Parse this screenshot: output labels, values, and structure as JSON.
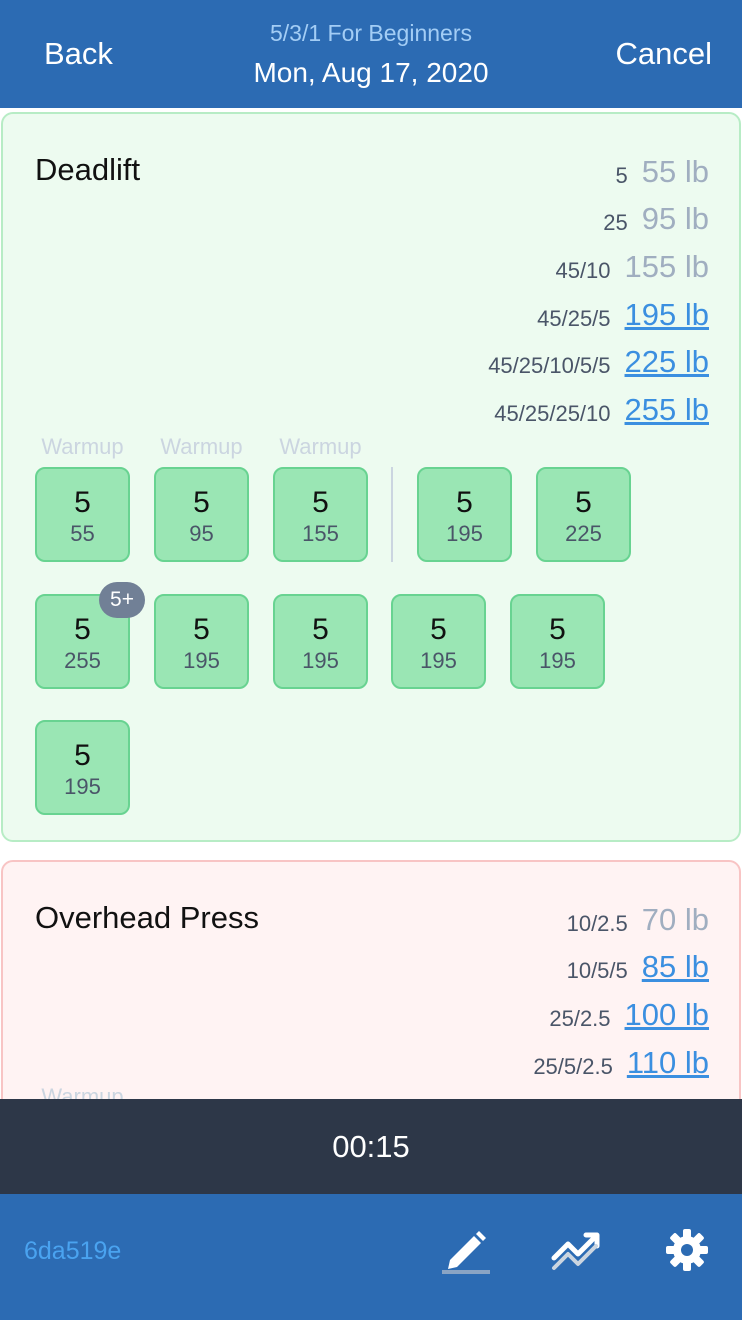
{
  "header": {
    "back_label": "Back",
    "program": "5/3/1 For Beginners",
    "date": "Mon, Aug 17, 2020",
    "cancel_label": "Cancel"
  },
  "exercises": [
    {
      "name": "Deadlift",
      "plates": [
        {
          "combo": "5",
          "weight": "55 lb"
        },
        {
          "combo": "25",
          "weight": "95 lb"
        },
        {
          "combo": "45/10",
          "weight": "155 lb"
        },
        {
          "combo": "45/25/5",
          "weight": "195 lb"
        },
        {
          "combo": "45/25/10/5/5",
          "weight": "225 lb"
        },
        {
          "combo": "45/25/25/10",
          "weight": "255 lb"
        }
      ],
      "warmup_label": "Warmup",
      "warmup_sets": [
        {
          "reps": "5",
          "weight": "55"
        },
        {
          "reps": "5",
          "weight": "95"
        },
        {
          "reps": "5",
          "weight": "155"
        }
      ],
      "work_sets": [
        {
          "reps": "5",
          "weight": "195"
        },
        {
          "reps": "5",
          "weight": "225"
        },
        {
          "reps": "5",
          "weight": "255",
          "badge": "5+"
        },
        {
          "reps": "5",
          "weight": "195"
        },
        {
          "reps": "5",
          "weight": "195"
        },
        {
          "reps": "5",
          "weight": "195"
        },
        {
          "reps": "5",
          "weight": "195"
        },
        {
          "reps": "5",
          "weight": "195"
        }
      ]
    },
    {
      "name": "Overhead Press",
      "plates": [
        {
          "combo": "10/2.5",
          "weight": "70 lb"
        },
        {
          "combo": "10/5/5",
          "weight": "85 lb"
        },
        {
          "combo": "25/2.5",
          "weight": "100 lb"
        },
        {
          "combo": "25/5/2.5",
          "weight": "110 lb"
        }
      ],
      "warmup_label": "Warmup"
    }
  ],
  "timer": "00:15",
  "footer": {
    "version": "6da519e",
    "icons": [
      "pencil-icon",
      "trend-icon",
      "gear-icon"
    ]
  },
  "colors": {
    "header_bg": "#2c6bb3",
    "timer_bg": "#2d3748",
    "set_done_bg": "#9ae6b4",
    "link": "#3b8fe0"
  }
}
